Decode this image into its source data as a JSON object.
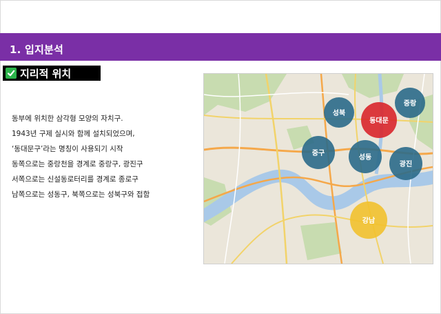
{
  "section": {
    "title": "1. 입지분석"
  },
  "badge": {
    "label": "지리적 위치",
    "icon": "check-icon"
  },
  "description": {
    "lines": [
      "동부에 위치한 삼각형 모양의 자치구.",
      "1943년 구제 실시와 함께 설치되었으며,",
      "‘동대문구’라는 명칭이 사용되기 시작",
      "동쪽으로는 중랑천을 경계로 중랑구, 광진구",
      "서쪽으로는 신설동로터리를 경계로 종로구",
      "남쪽으로는 성동구, 북쪽으로는 성북구와 접함"
    ]
  },
  "map": {
    "districts": [
      {
        "label": "성북",
        "color": "#2b6a8a"
      },
      {
        "label": "동대문",
        "color": "#d9262b"
      },
      {
        "label": "중랑",
        "color": "#2b6a8a"
      },
      {
        "label": "중구",
        "color": "#2b6a8a"
      },
      {
        "label": "성동",
        "color": "#2b6a8a"
      },
      {
        "label": "광진",
        "color": "#2b6a8a"
      },
      {
        "label": "강남",
        "color": "#f2c12e"
      }
    ]
  },
  "colors": {
    "section_bar": "#7a2fa6",
    "river": "#a9c9e8",
    "land": "#ebe6da",
    "park": "#c8dcb0"
  }
}
